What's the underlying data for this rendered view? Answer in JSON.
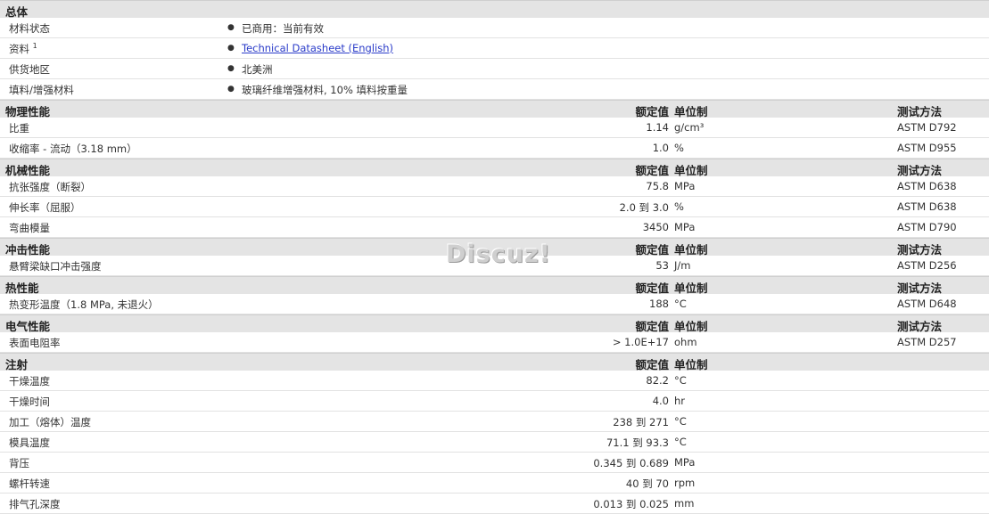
{
  "headers": {
    "value": "额定值",
    "unit": "单位制",
    "method": "测试方法"
  },
  "overview": {
    "title": "总体",
    "rows": [
      {
        "name": "材料状态",
        "info": "已商用：当前有效"
      },
      {
        "name": "资料",
        "sup": "1",
        "info": "Technical Datasheet (English)"
      },
      {
        "name": "供货地区",
        "info": "北美洲"
      },
      {
        "name": "填料/增强材料",
        "info": "玻璃纤维增强材料, 10% 填料按重量"
      }
    ]
  },
  "sections": [
    {
      "title": "物理性能",
      "show_method": true,
      "rows": [
        {
          "name": "比重",
          "value": "1.14",
          "unit": "g/cm³",
          "method": "ASTM D792"
        },
        {
          "name": "收缩率 - 流动（3.18 mm）",
          "value": "1.0",
          "unit": "%",
          "method": "ASTM D955"
        }
      ]
    },
    {
      "title": "机械性能",
      "show_method": true,
      "rows": [
        {
          "name": "抗张强度（断裂）",
          "value": "75.8",
          "unit": "MPa",
          "method": "ASTM D638"
        },
        {
          "name": "伸长率（屈服）",
          "value": "2.0 到  3.0",
          "unit": "%",
          "method": "ASTM D638"
        },
        {
          "name": "弯曲模量",
          "value": "3450",
          "unit": "MPa",
          "method": "ASTM D790"
        }
      ]
    },
    {
      "title": "冲击性能",
      "show_method": true,
      "rows": [
        {
          "name": "悬臂梁缺口冲击强度",
          "value": "53",
          "unit": "J/m",
          "method": "ASTM D256"
        }
      ]
    },
    {
      "title": "热性能",
      "show_method": true,
      "rows": [
        {
          "name": "热变形温度（1.8 MPa, 未退火）",
          "value": "188",
          "unit": "°C",
          "method": "ASTM D648"
        }
      ]
    },
    {
      "title": "电气性能",
      "show_method": true,
      "rows": [
        {
          "name": "表面电阻率",
          "value": "> 1.0E+17",
          "unit": "ohm",
          "method": "ASTM D257"
        }
      ]
    },
    {
      "title": "注射",
      "show_method": false,
      "rows": [
        {
          "name": "干燥温度",
          "value": "82.2",
          "unit": "°C",
          "method": ""
        },
        {
          "name": "干燥时间",
          "value": "4.0",
          "unit": "hr",
          "method": ""
        },
        {
          "name": "加工（熔体）温度",
          "value": "238 到  271",
          "unit": "°C",
          "method": ""
        },
        {
          "name": "模具温度",
          "value": "71.1 到  93.3",
          "unit": "°C",
          "method": ""
        },
        {
          "name": "背压",
          "value": "0.345 到  0.689",
          "unit": "MPa",
          "method": ""
        },
        {
          "name": "螺杆转速",
          "value": "40 到  70",
          "unit": "rpm",
          "method": ""
        },
        {
          "name": "排气孔深度",
          "value": "0.013 到  0.025",
          "unit": "mm",
          "method": ""
        }
      ]
    }
  ],
  "watermark": "Discuz!"
}
